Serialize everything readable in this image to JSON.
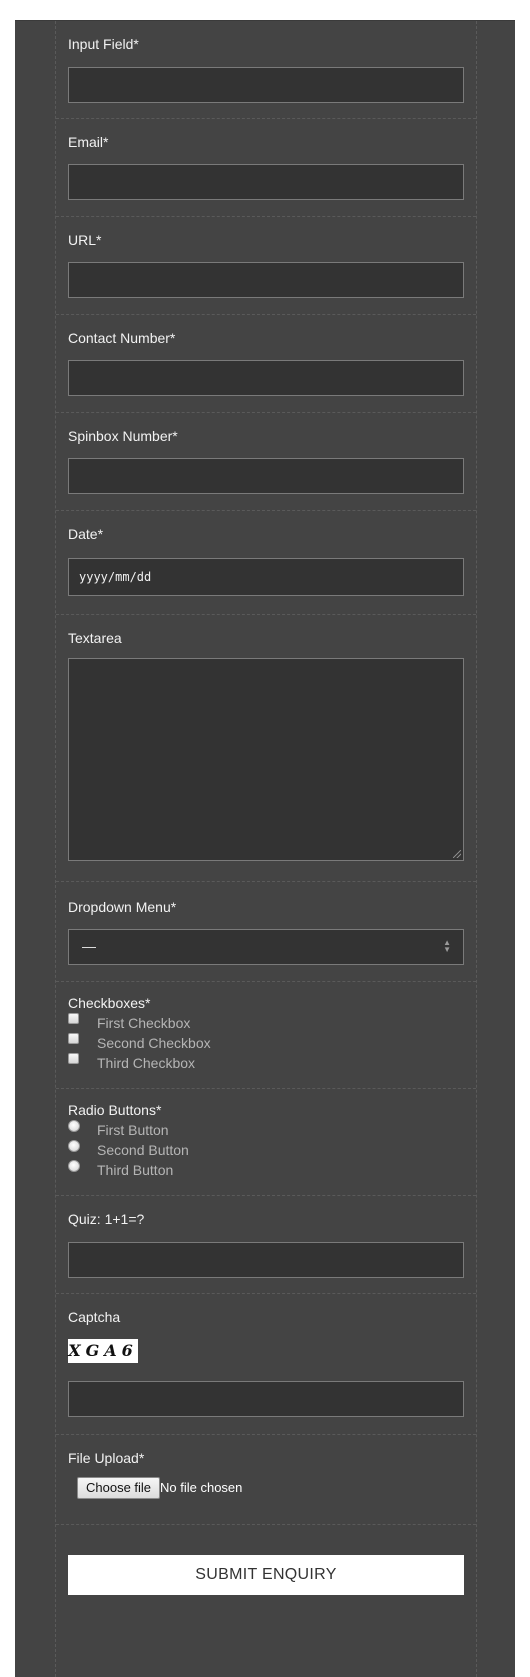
{
  "form": {
    "input_field_label": "Input Field*",
    "email_label": "Email*",
    "url_label": "URL*",
    "contact_label": "Contact Number*",
    "spinbox_label": "Spinbox Number*",
    "date_label": "Date*",
    "date_placeholder": "yyyy/mm/dd",
    "textarea_label": "Textarea",
    "dropdown_label": "Dropdown Menu*",
    "dropdown_value": "—",
    "checkboxes_label": "Checkboxes*",
    "checkboxes": [
      "First Checkbox",
      "Second Checkbox",
      "Third Checkbox"
    ],
    "radio_label": "Radio Buttons*",
    "radios": [
      "First Button",
      "Second Button",
      "Third Button"
    ],
    "quiz_label": "Quiz: 1+1=?",
    "captcha_label": "Captcha",
    "captcha_text": "XGA6",
    "file_label": "File Upload*",
    "file_button": "Choose file",
    "file_status": "No file chosen",
    "submit_label": "SUBMIT ENQUIRY"
  },
  "colors": {
    "panel_background": "#444444",
    "input_background": "#333333",
    "submit_background": "#ffffff"
  }
}
